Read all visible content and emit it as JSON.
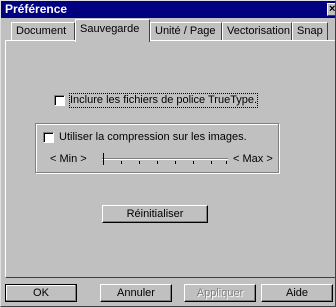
{
  "window": {
    "title": "Préférence",
    "close_glyph": "×"
  },
  "tabs": [
    {
      "label": "Document",
      "active": false
    },
    {
      "label": "Sauvegarde",
      "active": true
    },
    {
      "label": "Unité / Page",
      "active": false
    },
    {
      "label": "Vectorisation",
      "active": false
    },
    {
      "label": "Snap",
      "active": false
    }
  ],
  "options": {
    "include_fonts": {
      "label": "Inclure les fichiers de police TrueType.",
      "checked": false
    },
    "compression": {
      "label": "Utiliser la compression sur les images.",
      "checked": false
    }
  },
  "slider": {
    "min_label": "< Min >",
    "max_label": "< Max >",
    "value": 0
  },
  "reset_button": "Réinitialiser",
  "buttons": {
    "ok": "OK",
    "cancel": "Annuler",
    "apply": "Appliquer",
    "help": "Aide"
  }
}
